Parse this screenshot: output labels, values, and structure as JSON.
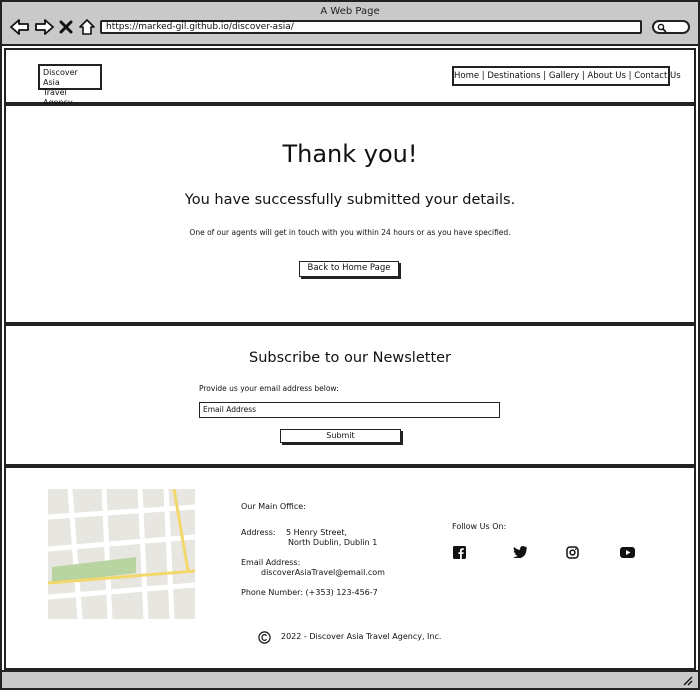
{
  "window": {
    "title": "A Web Page"
  },
  "browser": {
    "url": "https://marked-gil.github.io/discover-asia/"
  },
  "header": {
    "logo_line1": "Discover Asia",
    "logo_line2": "Travel Agency",
    "nav": [
      "Home",
      "Destinations",
      "Gallery",
      "About Us",
      "Contact Us"
    ]
  },
  "thanks": {
    "heading": "Thank you!",
    "subheading": "You have successfully submitted your details.",
    "message": "One of our agents will get in touch with you within 24 hours or as you have specified.",
    "button_label": "Back to Home Page"
  },
  "newsletter": {
    "heading": "Subscribe to our Newsletter",
    "prompt": "Provide us your email address below:",
    "email_placeholder": "Email Address",
    "submit_label": "Submit"
  },
  "footer": {
    "office_heading": "Our Main Office:",
    "address_label": "Address:",
    "address_line1": "5 Henry Street,",
    "address_line2": "North Dublin, Dublin 1",
    "email_label": "Email Address:",
    "email_value": "discoverAsiaTravel@email.com",
    "phone": "Phone Number: (+353) 123-456-7",
    "follow_label": "Follow Us On:",
    "social": [
      "facebook-icon",
      "twitter-icon",
      "instagram-icon",
      "youtube-icon"
    ],
    "copyright": "2022 - Discover Asia Travel Agency, Inc."
  }
}
